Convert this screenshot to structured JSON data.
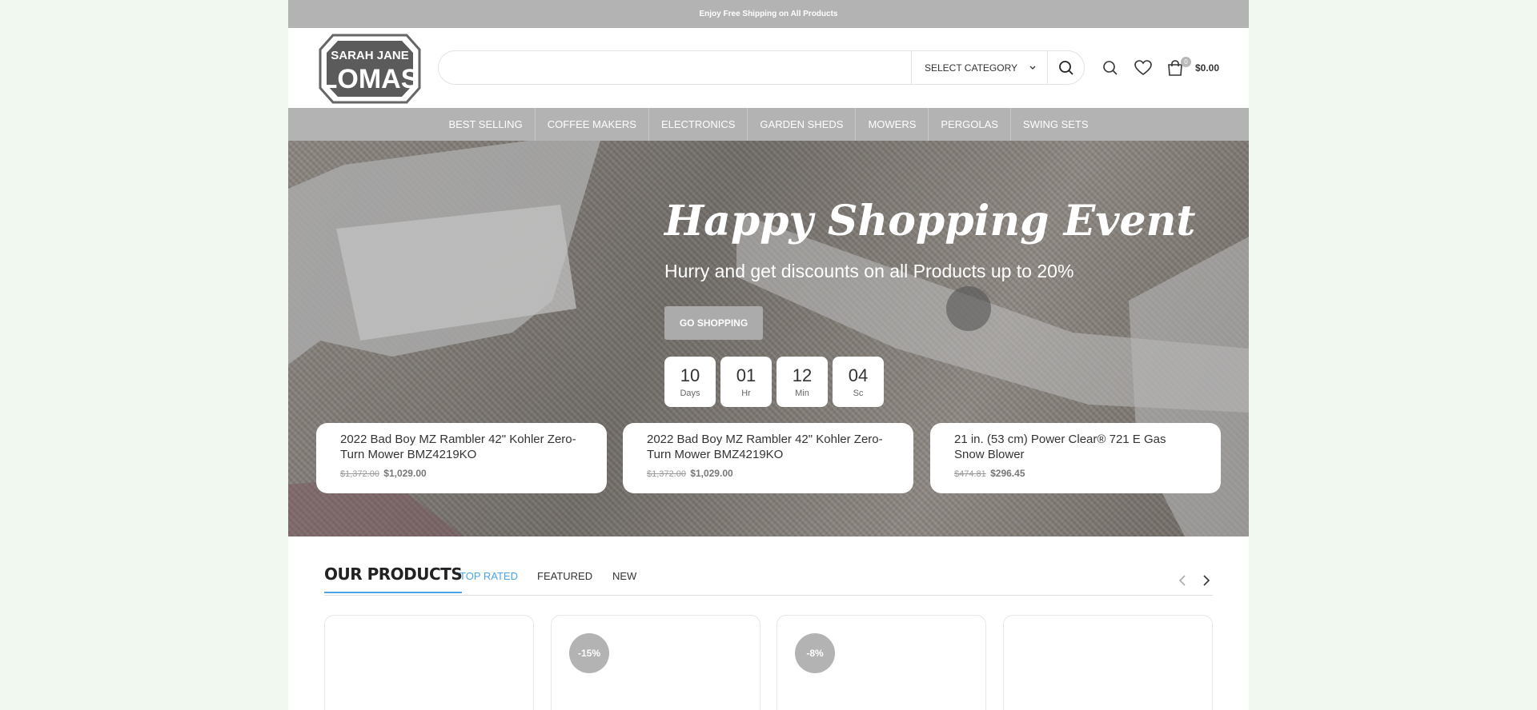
{
  "topbar": {
    "text": "Enjoy Free Shipping on All Products"
  },
  "logo": {
    "line1": "SARAH JANE",
    "line2": "LOMAS"
  },
  "search": {
    "placeholder": "",
    "category_label": "SELECT CATEGORY"
  },
  "cart": {
    "count": "0",
    "total": "$0.00"
  },
  "nav": {
    "items": [
      "BEST SELLING",
      "COFFEE MAKERS",
      "ELECTRONICS",
      "GARDEN SHEDS",
      "MOWERS",
      "PERGOLAS",
      "SWING SETS"
    ]
  },
  "hero": {
    "title": "Happy Shopping Event",
    "subtitle": "Hurry and get discounts on all Products up to 20%",
    "button": "GO SHOPPING",
    "countdown": [
      {
        "value": "10",
        "unit": "Days"
      },
      {
        "value": "01",
        "unit": "Hr"
      },
      {
        "value": "12",
        "unit": "Min"
      },
      {
        "value": "04",
        "unit": "Sc"
      }
    ],
    "promos": [
      {
        "title": "2022 Bad Boy MZ Rambler 42\" Kohler Zero-Turn Mower BMZ4219KO",
        "old_price": "$1,372.00",
        "new_price": "$1,029.00"
      },
      {
        "title": "2022 Bad Boy MZ Rambler 42\" Kohler Zero-Turn Mower BMZ4219KO",
        "old_price": "$1,372.00",
        "new_price": "$1,029.00"
      },
      {
        "title": "21 in. (53 cm) Power Clear® 721 E Gas Snow Blower",
        "old_price": "$474.81",
        "new_price": "$296.45"
      }
    ]
  },
  "products": {
    "title": "OUR PRODUCTS",
    "tabs": [
      "TOP RATED",
      "FEATURED",
      "NEW"
    ],
    "cards": [
      {
        "badge": ""
      },
      {
        "badge": "-15%"
      },
      {
        "badge": "-8%"
      },
      {
        "badge": ""
      }
    ]
  },
  "colors": {
    "accent": "#4da3e8",
    "bar_gray": "#b3b3b3",
    "page_bg": "#f1f8ef"
  }
}
